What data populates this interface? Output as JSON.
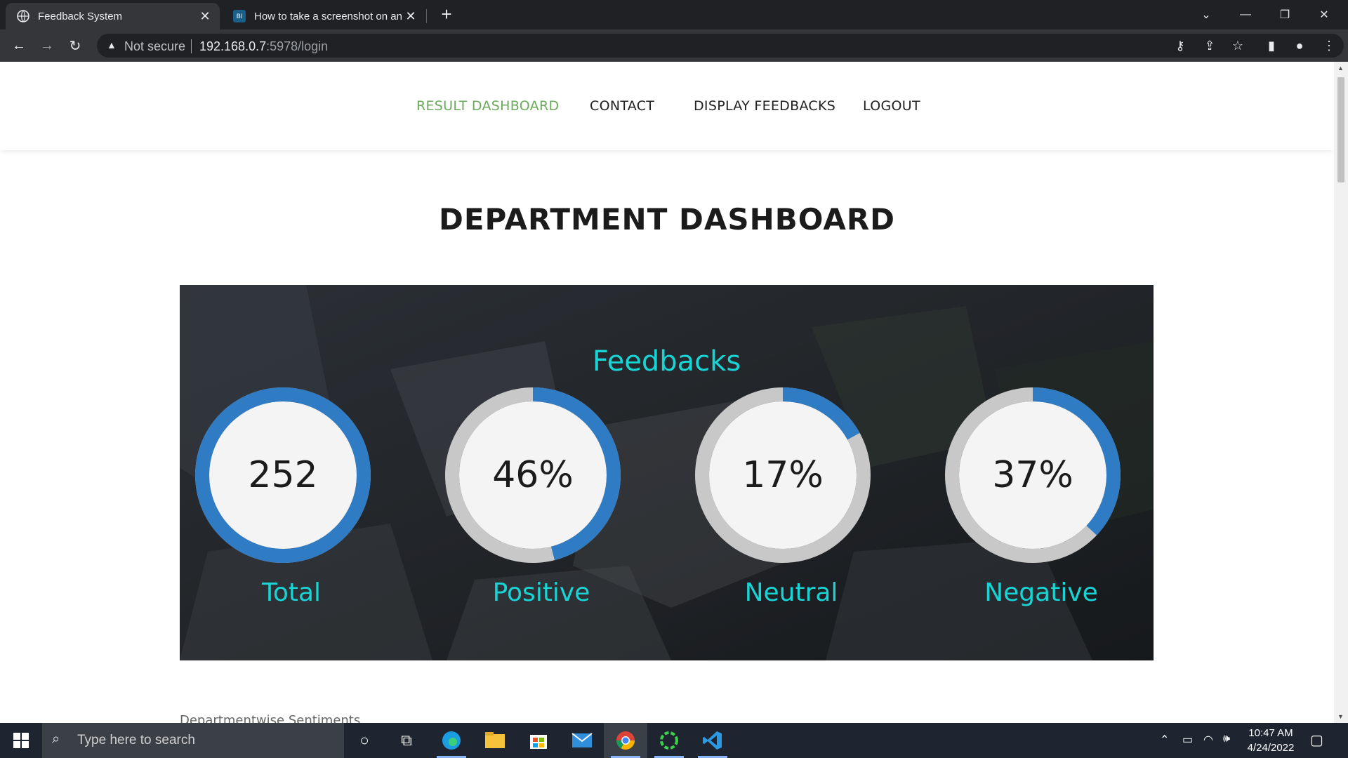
{
  "browser": {
    "tabs": [
      {
        "title": "Feedback System",
        "favicon": "globe-icon",
        "active": true
      },
      {
        "title": "How to take a screenshot on any",
        "favicon": "BI",
        "active": false
      }
    ],
    "security_label": "Not secure",
    "url_host": "192.168.0.7",
    "url_rest": ":5978/login"
  },
  "nav": {
    "items": [
      {
        "label": "RESULT DASHBOARD",
        "active": true
      },
      {
        "label": "CONTACT",
        "active": false
      },
      {
        "label": "DISPLAY FEEDBACKS",
        "active": false
      },
      {
        "label": "LOGOUT",
        "active": false
      }
    ]
  },
  "page": {
    "title": "DEPARTMENT DASHBOARD",
    "section_heading": "Feedbacks",
    "next_section": "Departmentwise Sentiments"
  },
  "stats": [
    {
      "label": "Total",
      "display": "252",
      "fraction": 1.0
    },
    {
      "label": "Positive",
      "display": "46%",
      "fraction": 0.46
    },
    {
      "label": "Neutral",
      "display": "17%",
      "fraction": 0.17
    },
    {
      "label": "Negative",
      "display": "37%",
      "fraction": 0.37
    }
  ],
  "colors": {
    "progress": "#2f7bc4",
    "track": "#c8c8c8",
    "dial_face": "#f4f4f4",
    "accent_text": "#18d4d4",
    "nav_active": "#6aaa5a"
  },
  "taskbar": {
    "search_placeholder": "Type here to search",
    "time": "10:47 AM",
    "date": "4/24/2022"
  }
}
